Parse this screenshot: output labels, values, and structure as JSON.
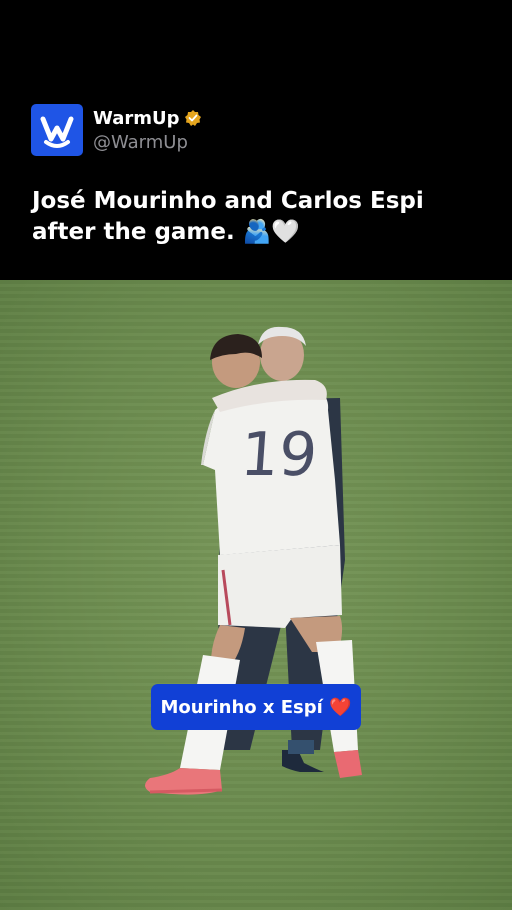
{
  "account": {
    "name": "WarmUp",
    "handle": "@WarmUp",
    "logo_icon": "warmup-logo-icon",
    "verified_icon": "verified-badge-icon",
    "brand_color": "#1f55e6",
    "verified_color": "#e5a51e"
  },
  "tweet": {
    "text": "José Mourinho and Carlos Espi after the game. 🫂🤍"
  },
  "media": {
    "description_icon": "football-players-hugging-image",
    "caption": "Mourinho x Espí ❤️",
    "caption_color": "#1140d6"
  }
}
